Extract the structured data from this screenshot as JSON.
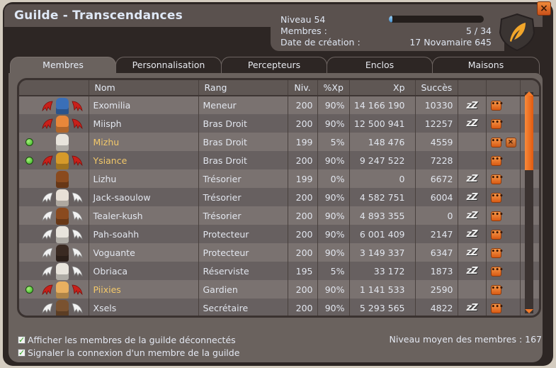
{
  "window": {
    "title": "Guilde - Transcendances",
    "close_label": "×"
  },
  "guild_info": {
    "level_label": "Niveau 54",
    "level_progress_fraction": 0.04,
    "members_label": "Membres :",
    "members_value": "5 / 34",
    "creation_label": "Date de création :",
    "creation_value": "17 Novamaire 645",
    "emblem_icon": "feather-shield-icon"
  },
  "tabs": [
    {
      "label": "Membres",
      "active": true
    },
    {
      "label": "Personnalisation",
      "active": false
    },
    {
      "label": "Percepteurs",
      "active": false
    },
    {
      "label": "Enclos",
      "active": false
    },
    {
      "label": "Maisons",
      "active": false
    }
  ],
  "table": {
    "columns": [
      "",
      "Nom",
      "Rang",
      "Niv.",
      "%Xp",
      "Xp",
      "Succès",
      "",
      ""
    ],
    "rows": [
      {
        "online": false,
        "wings": "red",
        "char_color": "#3a6fb8",
        "name": "Exomilia",
        "rank": "Meneur",
        "level": "200",
        "xp_pct": "90%",
        "xp": "14 166 190",
        "success": "10330",
        "afk": true,
        "kick": false
      },
      {
        "online": false,
        "wings": "red",
        "char_color": "#e8873a",
        "name": "Miisph",
        "rank": "Bras Droit",
        "level": "200",
        "xp_pct": "90%",
        "xp": "12 500 941",
        "success": "12257",
        "afk": true,
        "kick": false
      },
      {
        "online": true,
        "wings": "none",
        "char_color": "#e8e4dc",
        "name": "Mizhu",
        "rank": "Bras Droit",
        "level": "199",
        "xp_pct": "5%",
        "xp": "148 476",
        "success": "4559",
        "afk": false,
        "kick": true
      },
      {
        "online": true,
        "wings": "red",
        "char_color": "#d69a2a",
        "name": "Ysiance",
        "rank": "Bras Droit",
        "level": "200",
        "xp_pct": "90%",
        "xp": "9 247 522",
        "success": "7228",
        "afk": false,
        "kick": false
      },
      {
        "online": false,
        "wings": "none",
        "char_color": "#8a4a1e",
        "name": "Lizhu",
        "rank": "Trésorier",
        "level": "199",
        "xp_pct": "0%",
        "xp": "0",
        "success": "6672",
        "afk": true,
        "kick": false
      },
      {
        "online": false,
        "wings": "white",
        "char_color": "#e8e0d6",
        "name": "Jack-saoulow",
        "rank": "Trésorier",
        "level": "200",
        "xp_pct": "90%",
        "xp": "4 582 751",
        "success": "6004",
        "afk": true,
        "kick": false
      },
      {
        "online": false,
        "wings": "white",
        "char_color": "#8a4a1e",
        "name": "Tealer-kush",
        "rank": "Trésorier",
        "level": "200",
        "xp_pct": "90%",
        "xp": "4 893 355",
        "success": "0",
        "afk": true,
        "kick": false
      },
      {
        "online": false,
        "wings": "white",
        "char_color": "#e8e4dc",
        "name": "Pah-soahh",
        "rank": "Protecteur",
        "level": "200",
        "xp_pct": "90%",
        "xp": "6 001 409",
        "success": "2147",
        "afk": true,
        "kick": false
      },
      {
        "online": false,
        "wings": "white",
        "char_color": "#3a2a22",
        "name": "Voguante",
        "rank": "Protecteur",
        "level": "200",
        "xp_pct": "90%",
        "xp": "3 149 337",
        "success": "6347",
        "afk": true,
        "kick": false
      },
      {
        "online": false,
        "wings": "white",
        "char_color": "#e8e4dc",
        "name": "Obriaca",
        "rank": "Réserviste",
        "level": "195",
        "xp_pct": "5%",
        "xp": "33 172",
        "success": "1873",
        "afk": true,
        "kick": false
      },
      {
        "online": true,
        "wings": "red",
        "char_color": "#e8b060",
        "name": "Piixies",
        "rank": "Gardien",
        "level": "200",
        "xp_pct": "90%",
        "xp": "1 141 533",
        "success": "2590",
        "afk": false,
        "kick": false
      },
      {
        "online": false,
        "wings": "white",
        "char_color": "#7a5230",
        "name": "Xsels",
        "rank": "Secrétaire",
        "level": "200",
        "xp_pct": "90%",
        "xp": "5 293 565",
        "success": "4822",
        "afk": true,
        "kick": false
      }
    ],
    "afk_label": "zZ",
    "menu_label": "•••",
    "kick_label": "×"
  },
  "options": {
    "show_offline": {
      "label": "Afficher les membres de la guilde déconnectés",
      "checked": true
    },
    "notify_login": {
      "label": "Signaler la connexion d'un membre de la guilde",
      "checked": true
    },
    "check_mark": "✓"
  },
  "footer": {
    "avg_level": "Niveau moyen des membres : 167"
  },
  "colors": {
    "accent_orange": "#f07a2a",
    "online_name": "#f2c86a",
    "online_dot": "#3fc22a",
    "xp_bar": "#5fa8e2"
  }
}
